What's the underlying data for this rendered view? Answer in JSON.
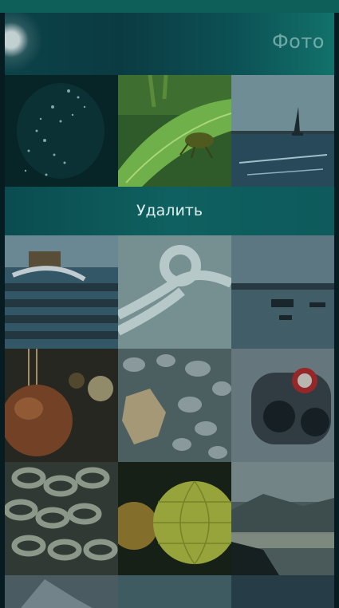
{
  "header": {
    "title": "Фото"
  },
  "context_menu": {
    "delete_label": "Удалить"
  },
  "colors": {
    "accent": "#0f6060",
    "background": "#061c20"
  },
  "grid": {
    "photos": [
      {
        "name": "water-splash"
      },
      {
        "name": "grasshopper-on-leaf"
      },
      {
        "name": "sailboat-at-sea"
      },
      {
        "name": "stone-pier-waves"
      },
      {
        "name": "rope-knot"
      },
      {
        "name": "boats-on-calm-lake"
      },
      {
        "name": "hanging-gourd-bokeh"
      },
      {
        "name": "pebbles-and-leaves"
      },
      {
        "name": "coin-binoculars"
      },
      {
        "name": "metal-chains"
      },
      {
        "name": "glowing-lantern"
      },
      {
        "name": "misty-mountains-sunset"
      },
      {
        "name": "partial-photo-1"
      },
      {
        "name": "partial-photo-2"
      },
      {
        "name": "partial-photo-3"
      }
    ]
  }
}
